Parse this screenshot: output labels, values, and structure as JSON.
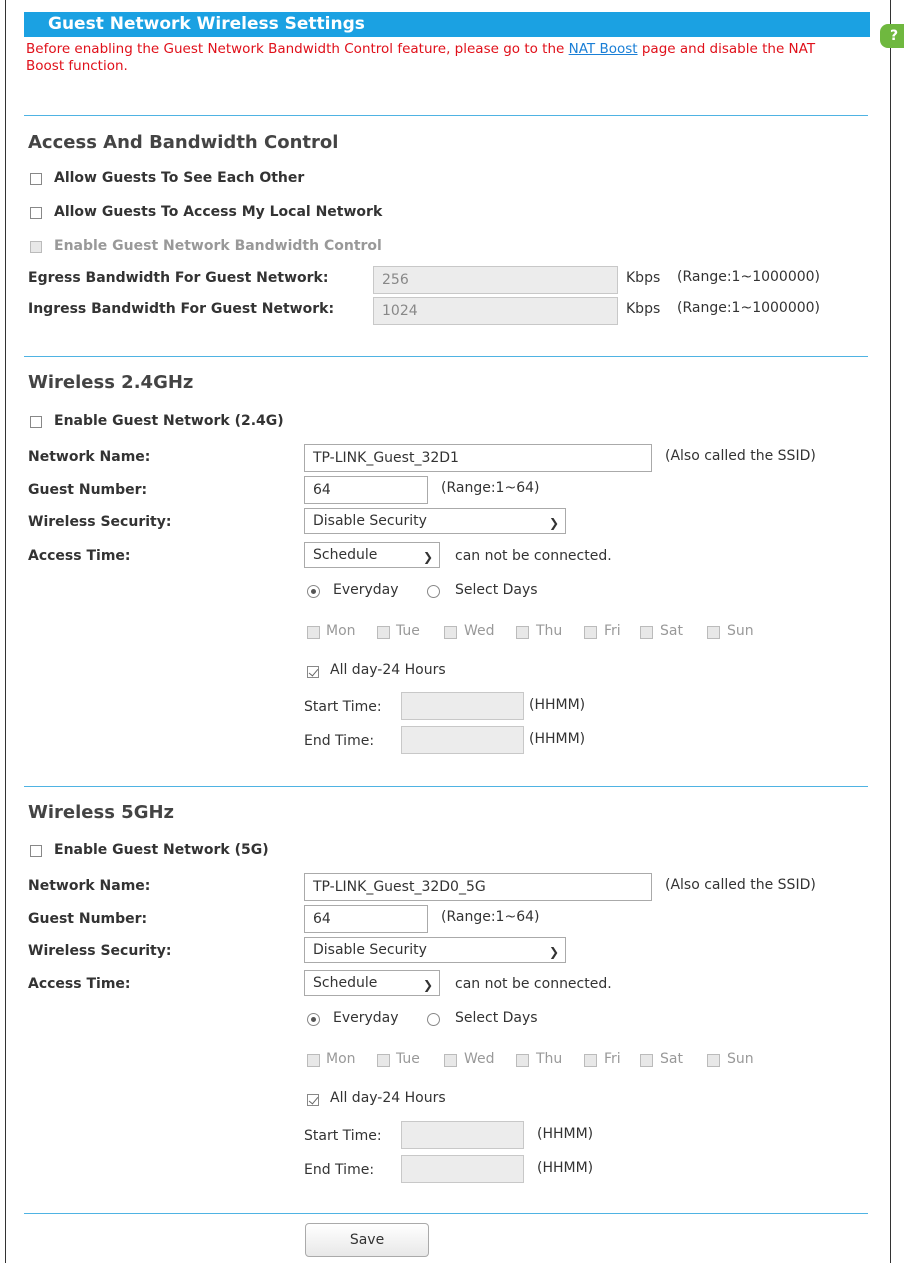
{
  "title": "Guest Network Wireless Settings",
  "help_icon": "?",
  "notice": {
    "before": "Before enabling the Guest Network Bandwidth Control feature, please go to the ",
    "link": "NAT Boost",
    "after": " page and disable the NAT Boost function."
  },
  "access": {
    "title": "Access And Bandwidth Control",
    "allow_see_each_other": "Allow Guests To See Each Other",
    "allow_local_network": "Allow Guests To Access My Local Network",
    "enable_bandwidth": "Enable Guest Network Bandwidth Control",
    "egress_label": "Egress Bandwidth For Guest Network:",
    "egress_value": "256",
    "ingress_label": "Ingress Bandwidth For Guest Network:",
    "ingress_value": "1024",
    "unit": "Kbps",
    "range": "(Range:1~1000000)"
  },
  "w24": {
    "title": "Wireless 2.4GHz",
    "enable": "Enable Guest Network (2.4G)",
    "network_name_label": "Network Name:",
    "network_name": "TP-LINK_Guest_32D1",
    "ssid_note": "(Also called the SSID)",
    "guest_number_label": "Guest Number:",
    "guest_number": "64",
    "guest_range": "(Range:1~64)",
    "security_label": "Wireless Security:",
    "security": "Disable Security",
    "access_time_label": "Access Time:",
    "access_time": "Schedule",
    "access_note": "can not be connected.",
    "everyday": "Everyday",
    "select_days": "Select Days",
    "days": [
      "Mon",
      "Tue",
      "Wed",
      "Thu",
      "Fri",
      "Sat",
      "Sun"
    ],
    "all_day": "All day-24 Hours",
    "start_label": "Start Time:",
    "end_label": "End Time:",
    "hhmm": "(HHMM)"
  },
  "w5": {
    "title": "Wireless 5GHz",
    "enable": "Enable Guest Network (5G)",
    "network_name_label": "Network Name:",
    "network_name": "TP-LINK_Guest_32D0_5G",
    "ssid_note": "(Also called the SSID)",
    "guest_number_label": "Guest Number:",
    "guest_number": "64",
    "guest_range": "(Range:1~64)",
    "security_label": "Wireless Security:",
    "security": "Disable Security",
    "access_time_label": "Access Time:",
    "access_time": "Schedule",
    "access_note": "can not be connected.",
    "everyday": "Everyday",
    "select_days": "Select Days",
    "days": [
      "Mon",
      "Tue",
      "Wed",
      "Thu",
      "Fri",
      "Sat",
      "Sun"
    ],
    "all_day": "All day-24 Hours",
    "start_label": "Start Time:",
    "end_label": "End Time:",
    "hhmm": "(HHMM)"
  },
  "save_label": "Save"
}
